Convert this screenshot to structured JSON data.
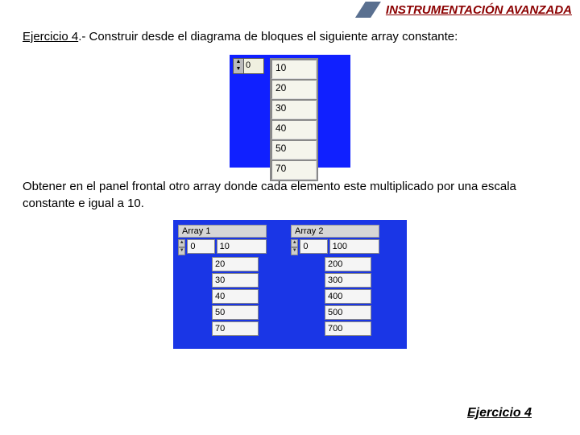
{
  "header": {
    "title": "INSTRUMENTACIÓN AVANZADA"
  },
  "exercise": {
    "label": "Ejercicio 4",
    "sep": ".- ",
    "text": "Construir desde el diagrama de bloques el siguiente array constante:"
  },
  "panel1": {
    "index": "0",
    "values": [
      "10",
      "20",
      "30",
      "40",
      "50",
      "70"
    ]
  },
  "instruction2": "Obtener en el panel frontal otro array donde cada elemento este multiplicado por una escala constante e igual a 10.",
  "panel2": {
    "arrays": [
      {
        "title": "Array 1",
        "index": "0",
        "values": [
          "10",
          "20",
          "30",
          "40",
          "50",
          "70"
        ]
      },
      {
        "title": "Array 2",
        "index": "0",
        "values": [
          "100",
          "200",
          "300",
          "400",
          "500",
          "700"
        ]
      }
    ]
  },
  "footer": {
    "link": "Ejercicio 4"
  }
}
